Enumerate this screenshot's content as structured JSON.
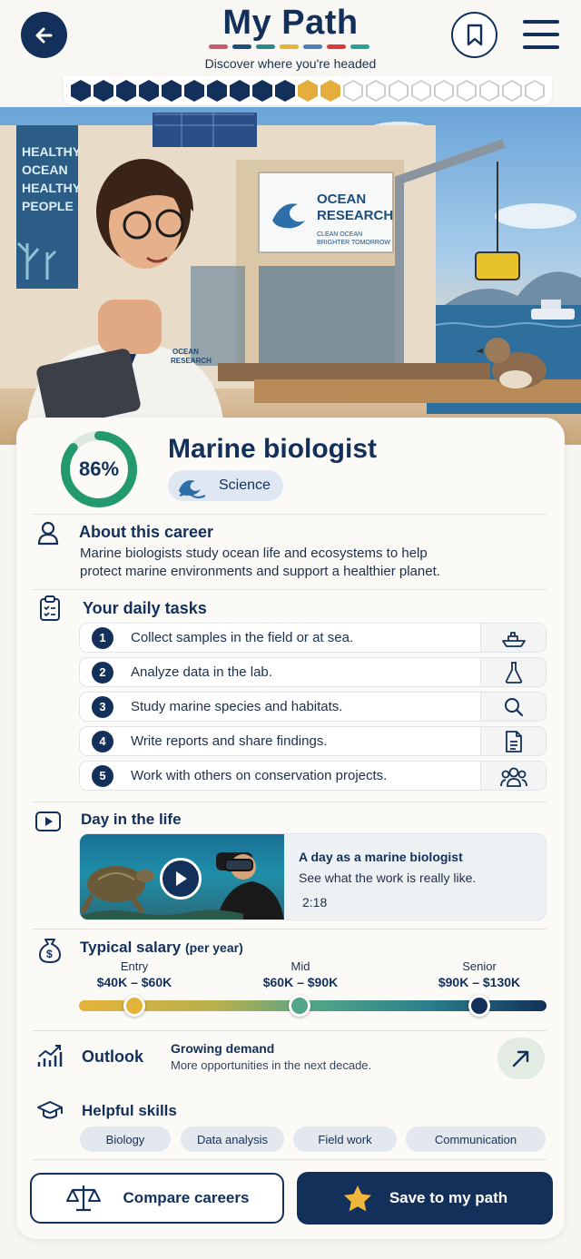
{
  "header": {
    "title": "My Path",
    "subtitle": "Discover where you're headed",
    "title_dash_colors": [
      "#c95a6b",
      "#1f4d7a",
      "#2a8a8a",
      "#e4b33a",
      "#4e7fbf",
      "#d83b3b",
      "#23a39a"
    ],
    "progress": {
      "filled": 10,
      "current": 2,
      "empty": 9
    }
  },
  "hero": {
    "sign_title_line1": "OCEAN",
    "sign_title_line2": "RESEARCH",
    "sign_sub_line1": "CLEAN OCEAN",
    "sign_sub_line2": "BRIGHTER TOMORROW",
    "banner_lines": [
      "HEALTHY",
      "OCEAN",
      "HEALTHY",
      "PEOPLE"
    ],
    "coat_line1": "OCEAN",
    "coat_line2": "RESEARCH"
  },
  "career": {
    "match_percent": "86%",
    "match_value": 0.86,
    "title": "Marine biologist",
    "category": "Science"
  },
  "about": {
    "title": "About this career",
    "line1": "Marine biologists study ocean life and ecosystems to help",
    "line2": "protect marine environments and support a healthier planet."
  },
  "tasks": {
    "title": "Your daily tasks",
    "items": [
      {
        "num": "1",
        "text": "Collect samples in the field or at sea.",
        "icon": "boat-icon"
      },
      {
        "num": "2",
        "text": "Analyze data in the lab.",
        "icon": "flask-icon"
      },
      {
        "num": "3",
        "text": "Study marine species and habitats.",
        "icon": "magnifier-icon"
      },
      {
        "num": "4",
        "text": "Write reports and share findings.",
        "icon": "document-icon"
      },
      {
        "num": "5",
        "text": "Work with others on conservation projects.",
        "icon": "group-icon"
      }
    ]
  },
  "day": {
    "title": "Day in the life",
    "video_title": "A day as a marine biologist",
    "video_sub": "See what the work is really like.",
    "duration": "2:18"
  },
  "salary": {
    "title": "Typical salary",
    "unit": "(per year)",
    "levels": [
      {
        "label": "Entry",
        "range": "$40K – $60K",
        "color": "#e4b33a"
      },
      {
        "label": "Mid",
        "range": "$60K – $90K",
        "color": "#53a587"
      },
      {
        "label": "Senior",
        "range": "$90K – $130K",
        "color": "#12305a"
      }
    ]
  },
  "outlook": {
    "title": "Outlook",
    "headline": "Growing demand",
    "detail": "More opportunities in the next decade."
  },
  "skills": {
    "title": "Helpful skills",
    "items": [
      "Biology",
      "Data analysis",
      "Field work",
      "Communication"
    ]
  },
  "actions": {
    "compare": "Compare careers",
    "save": "Save to my path"
  },
  "colors": {
    "navy": "#12305a",
    "gold": "#e4b33a",
    "teal": "#2a9d8f"
  }
}
